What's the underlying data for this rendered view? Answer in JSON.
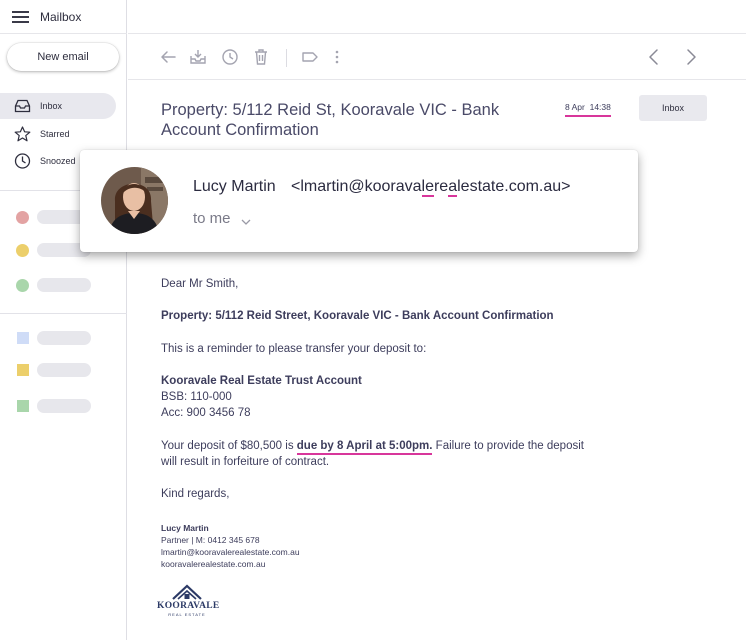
{
  "app": {
    "title": "Mailbox"
  },
  "sidebar": {
    "new_email_label": "New email",
    "nav": [
      {
        "label": "Inbox",
        "icon": "inbox-icon",
        "active": true
      },
      {
        "label": "Starred",
        "icon": "star-icon"
      },
      {
        "label": "Snoozed",
        "icon": "clock-icon"
      }
    ],
    "label_colors": [
      "#e3a3a3",
      "#eccf6b",
      "#a9d6ab"
    ],
    "folder_colors": [
      "#cfdcf7",
      "#eccf6b",
      "#a9d6ab"
    ]
  },
  "toolbar": {
    "icons": [
      "back-arrow-icon",
      "archive-icon",
      "snooze-clock-icon",
      "trash-icon",
      "label-tag-icon",
      "more-vertical-icon",
      "prev-chevron-icon",
      "next-chevron-icon"
    ]
  },
  "email": {
    "subject": "Property: 5/112 Reid St, Kooravale VIC - Bank Account Confirmation",
    "date": "8 Apr",
    "time": "14:38",
    "folder_button": "Inbox",
    "sender_name": "Lucy Martin",
    "email_part1": "<lmartin@koorava",
    "email_u1": "le",
    "email_part2": "re",
    "email_u2": "a",
    "email_part3": "lestate.com.au>",
    "to": "to me",
    "greeting": "Dear Mr Smith,",
    "heading": "Property: 5/112 Reid Street, Kooravale VIC - Bank Account Confirmation",
    "reminder": "This is a reminder to please transfer your deposit to:",
    "account_name": "Kooravale Real Estate Trust Account",
    "bsb": "BSB: 110-000",
    "acc": "Acc: 900 3456 78",
    "deposit_pre": "Your deposit of $80,500 is ",
    "deposit_due": "due by 8 April at 5:00pm.",
    "deposit_post": " Failure to provide the deposit",
    "deposit_line2": "will result in forfeiture of contract.",
    "signoff": "Kind regards,",
    "signature": {
      "name": "Lucy Martin",
      "role": "Partner | M: 0412 345 678",
      "email": "lmartin@kooravalerealestate.com.au",
      "website": "kooravalerealestate.com.au"
    },
    "logo_text": "KOORAVALE",
    "logo_sub": "REAL ESTATE"
  },
  "colors": {
    "accent_underline": "#d8369b"
  }
}
